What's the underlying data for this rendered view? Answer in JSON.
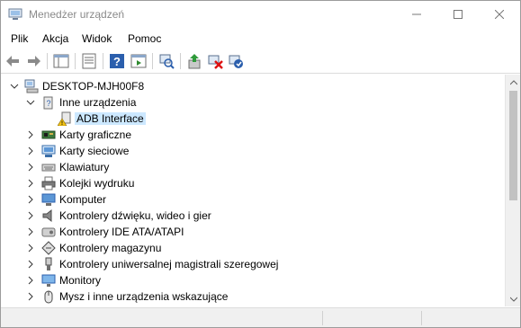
{
  "window": {
    "title": "Menedżer urządzeń",
    "controls": [
      "minimize",
      "maximize",
      "close"
    ]
  },
  "menu": [
    "Plik",
    "Akcja",
    "Widok",
    "Pomoc"
  ],
  "toolbar": {
    "icons": [
      "back-icon",
      "forward-icon",
      "show-hide-console-tree-icon",
      "properties-icon",
      "help-icon",
      "run-icon",
      "scan-hardware-icon",
      "update-driver-icon",
      "disable-device-icon",
      "uninstall-device-icon"
    ]
  },
  "tree": {
    "root": "DESKTOP-MJH00F8",
    "items": [
      {
        "label": "Inne urządzenia",
        "icon": "other-devices-icon",
        "expanded": true
      },
      {
        "label": "ADB Interface",
        "icon": "warning-device-icon",
        "child": true,
        "selected": true
      },
      {
        "label": "Karty graficzne",
        "icon": "display-adapter-icon"
      },
      {
        "label": "Karty sieciowe",
        "icon": "network-adapter-icon"
      },
      {
        "label": "Klawiatury",
        "icon": "keyboard-icon"
      },
      {
        "label": "Kolejki wydruku",
        "icon": "printer-icon"
      },
      {
        "label": "Komputer",
        "icon": "computer-icon"
      },
      {
        "label": "Kontrolery dźwięku, wideo i gier",
        "icon": "sound-icon"
      },
      {
        "label": "Kontrolery IDE ATA/ATAPI",
        "icon": "ide-icon"
      },
      {
        "label": "Kontrolery magazynu",
        "icon": "storage-icon"
      },
      {
        "label": "Kontrolery uniwersalnej magistrali szeregowej",
        "icon": "usb-icon"
      },
      {
        "label": "Monitory",
        "icon": "monitor-icon"
      },
      {
        "label": "Mysz i inne urządzenia wskazujące",
        "icon": "mouse-icon"
      }
    ]
  },
  "colors": {
    "selection": "#cce8ff",
    "accent": "#2b6cc4"
  }
}
